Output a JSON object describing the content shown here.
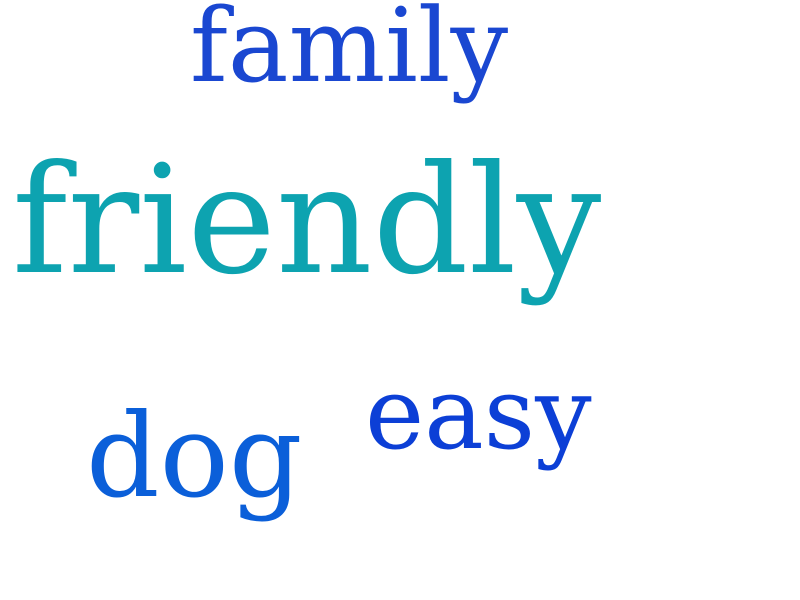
{
  "words": [
    {
      "key": "family",
      "text": "family",
      "color": "#1a47d1"
    },
    {
      "key": "friendly",
      "text": "friendly",
      "color": "#0da3b0"
    },
    {
      "key": "easy",
      "text": "easy",
      "color": "#0c3fd6"
    },
    {
      "key": "dog",
      "text": "dog",
      "color": "#0b5fd9"
    }
  ]
}
